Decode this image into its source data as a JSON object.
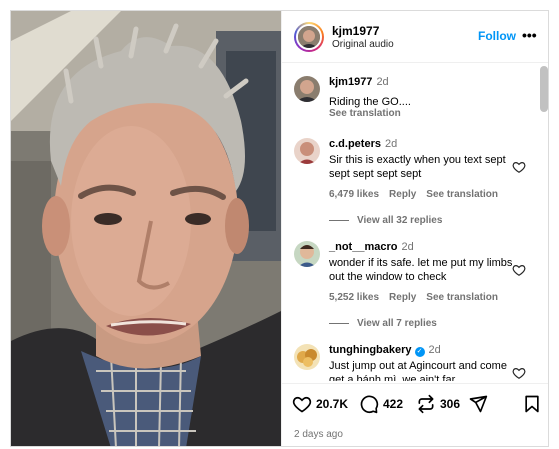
{
  "post": {
    "username": "kjm1977",
    "audio": "Original audio",
    "follow_label": "Follow",
    "more_label": "•••",
    "date": "2 days ago"
  },
  "caption": {
    "username": "kjm1977",
    "time": "2d",
    "text": "Riding the GO....",
    "see_translation": "See translation"
  },
  "comments": [
    {
      "username": "c.d.peters",
      "time": "2d",
      "text": "Sir this is exactly when you text sept sept sept sept sept",
      "likes": "6,479 likes",
      "reply": "Reply",
      "see_translation": "See translation",
      "view_replies": "View all 32 replies"
    },
    {
      "username": "_not__macro",
      "time": "2d",
      "text": "wonder if its safe. let me put my limbs out the window to check",
      "likes": "5,252 likes",
      "reply": "Reply",
      "see_translation": "See translation",
      "view_replies": "View all 7 replies"
    },
    {
      "username": "tunghingbakery",
      "verified": true,
      "time": "2d",
      "text": "Just jump out at Agincourt and come get a bánh mì, we ain't far"
    }
  ],
  "actions": {
    "likes": "20.7K",
    "comments": "422",
    "reposts": "306"
  },
  "icons": [
    "heart-icon",
    "comment-icon",
    "repost-icon",
    "share-icon",
    "bookmark-icon",
    "more-icon",
    "verified-icon"
  ],
  "colors": {
    "accent": "#0095f6",
    "muted": "#737373",
    "border": "#dbdbdb"
  }
}
